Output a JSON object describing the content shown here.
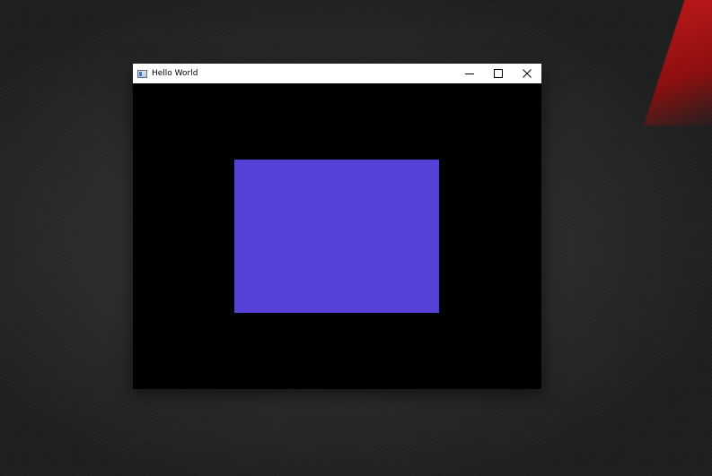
{
  "window": {
    "title": "Hello World",
    "controls": {
      "minimize": "minimize-icon",
      "maximize": "maximize-icon",
      "close": "close-icon"
    }
  },
  "canvas": {
    "background_color": "#000000",
    "rectangle_color": "#5540d8"
  },
  "desktop": {
    "accent_color": "#c41414"
  }
}
